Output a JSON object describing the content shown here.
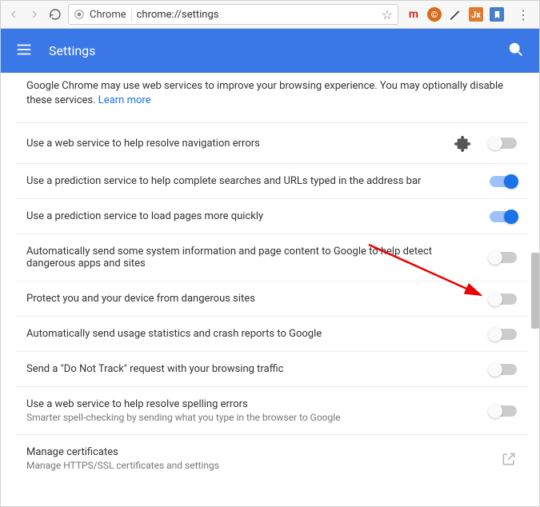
{
  "browser": {
    "chrome_label": "Chrome",
    "url": "chrome://settings",
    "ext_m": "m",
    "ext_jx": "Jx"
  },
  "header": {
    "title": "Settings"
  },
  "intro": {
    "text": "Google Chrome may use web services to improve your browsing experience. You may optionally disable these services.",
    "link": "Learn more"
  },
  "rows": [
    {
      "title": "Use a web service to help resolve navigation errors",
      "sub": "",
      "on": false,
      "hasPuzzle": true
    },
    {
      "title": "Use a prediction service to help complete searches and URLs typed in the address bar",
      "sub": "",
      "on": true
    },
    {
      "title": "Use a prediction service to load pages more quickly",
      "sub": "",
      "on": true
    },
    {
      "title": "Automatically send some system information and page content to Google to help detect dangerous apps and sites",
      "sub": "",
      "on": false
    },
    {
      "title": "Protect you and your device from dangerous sites",
      "sub": "",
      "on": false
    },
    {
      "title": "Automatically send usage statistics and crash reports to Google",
      "sub": "",
      "on": false
    },
    {
      "title": "Send a \"Do Not Track\" request with your browsing traffic",
      "sub": "",
      "on": false
    },
    {
      "title": "Use a web service to help resolve spelling errors",
      "sub": "Smarter spell-checking by sending what you type in the browser to Google",
      "on": false
    },
    {
      "title": "Manage certificates",
      "sub": "Manage HTTPS/SSL certificates and settings",
      "link": true
    }
  ]
}
